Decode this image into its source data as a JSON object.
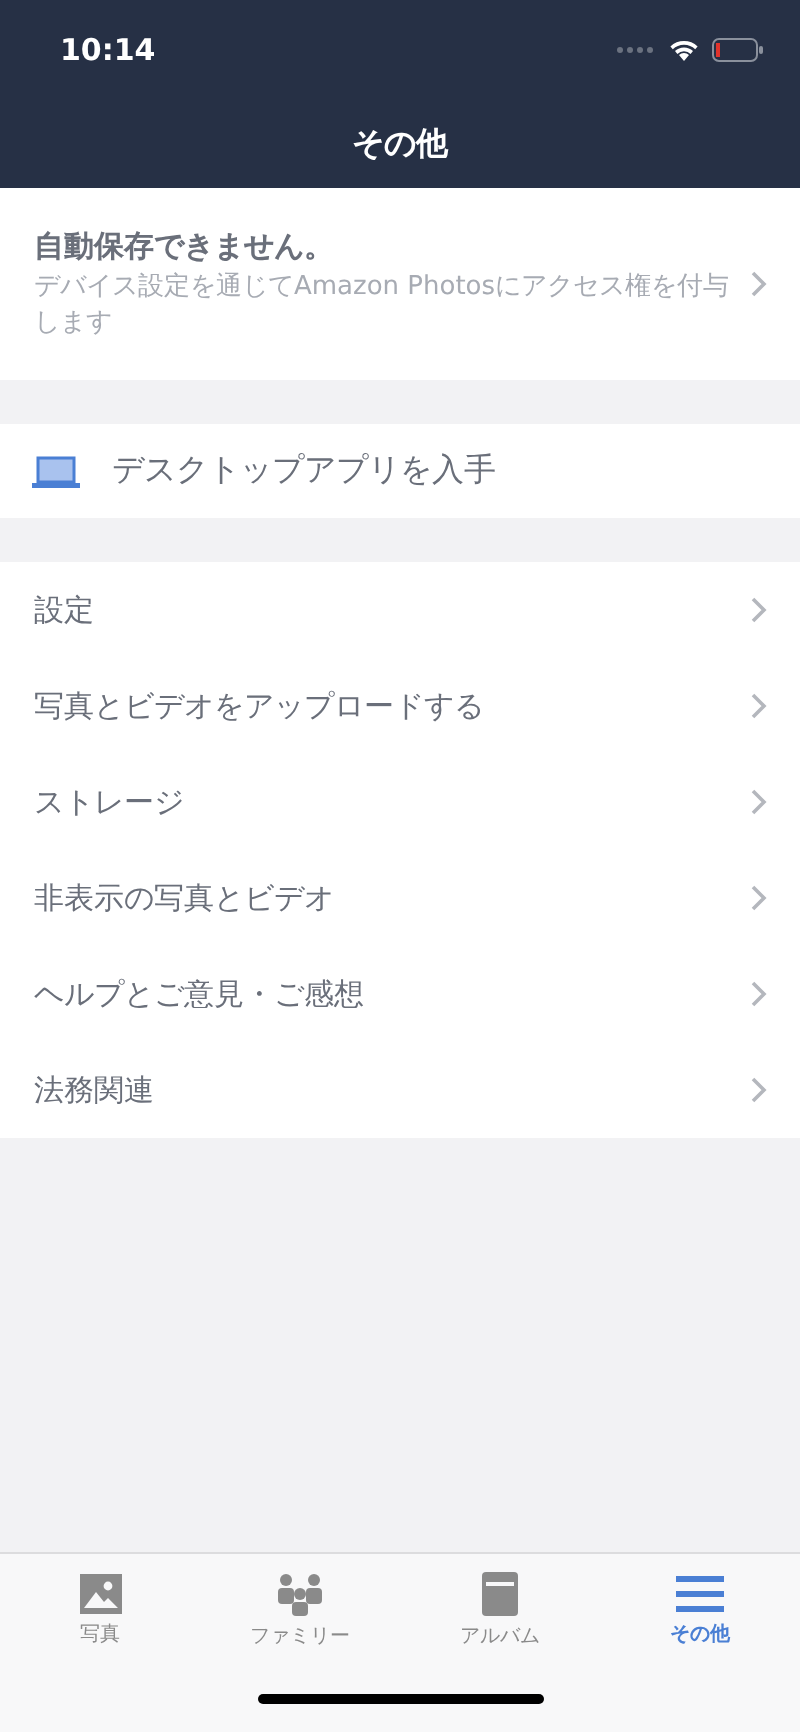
{
  "status_bar": {
    "time": "10:14"
  },
  "nav": {
    "title": "その他"
  },
  "banner": {
    "title": "自動保存できません。",
    "message": "デバイス設定を通じてAmazon Photosにアクセス権を付与します"
  },
  "desktop_link": {
    "label": "デスクトップアプリを入手"
  },
  "menu": [
    {
      "label": "設定"
    },
    {
      "label": "写真とビデオをアップロードする"
    },
    {
      "label": "ストレージ"
    },
    {
      "label": "非表示の写真とビデオ"
    },
    {
      "label": "ヘルプとご意見・ご感想"
    },
    {
      "label": "法務関連"
    }
  ],
  "tabs": [
    {
      "label": "写真",
      "kind": "photo",
      "selected": false
    },
    {
      "label": "ファミリー",
      "kind": "family",
      "selected": false
    },
    {
      "label": "アルバム",
      "kind": "album",
      "selected": false
    },
    {
      "label": "その他",
      "kind": "more",
      "selected": true
    }
  ]
}
